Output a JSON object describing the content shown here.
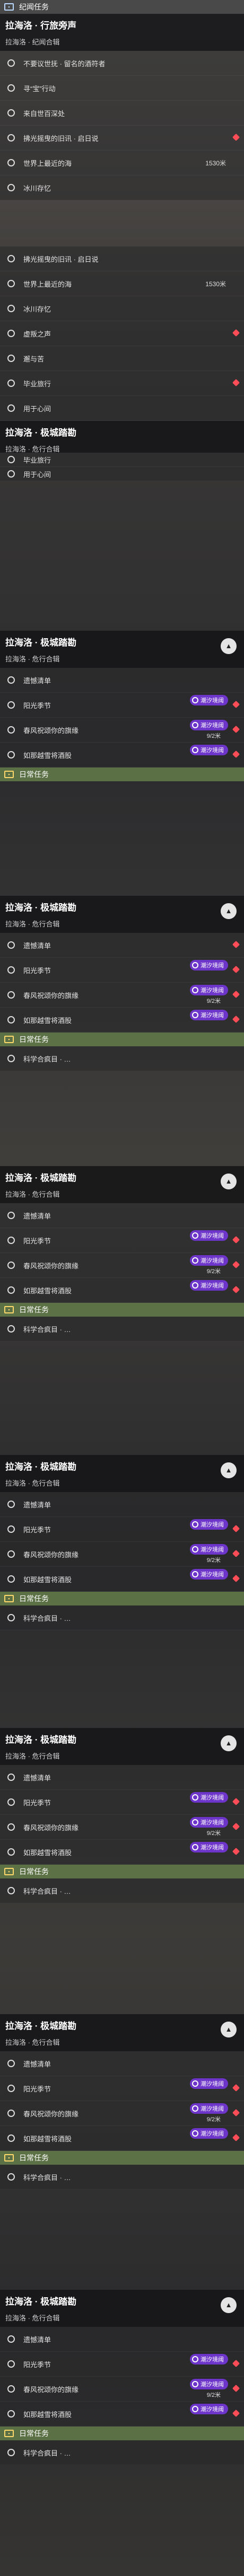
{
  "app": {
    "title": "任务追踪"
  },
  "icons": {
    "circle": "radio-circle-icon",
    "chevron": "chevron-up-icon",
    "marker": "red-diamond-marker-icon",
    "tag": "purple-story-tag-icon"
  },
  "colors": {
    "tag_purple": "#6d35c9",
    "marker_red": "#ff4d57",
    "daily_green": "#607646",
    "header_dark": "#161618"
  },
  "top": {
    "category": "纪闻任务",
    "header": {
      "title": "拉海洛 · 行旅旁声",
      "subtitle": "拉海洛 · 纪闻合辑"
    },
    "items": [
      {
        "label": "不要议世抚 · 留名的酒符者"
      },
      {
        "label": "寻“宝”行动"
      },
      {
        "label": "来自世百深处"
      },
      {
        "label": "拂光摇曳的旧讯 · 启日说"
      },
      {
        "label": "世界上最近的海",
        "distance": "1530米"
      },
      {
        "label": "冰川存忆"
      }
    ]
  },
  "second": {
    "items": [
      {
        "label": "拂光摇曳的旧讯 · 启日说"
      },
      {
        "label": "世界上最近的海",
        "distance": "1530米"
      },
      {
        "label": "冰川存忆"
      },
      {
        "label": "虚叛之声"
      },
      {
        "label": "邂与苦"
      },
      {
        "label": "毕业旅行"
      },
      {
        "label": "用于心间"
      }
    ]
  },
  "third": {
    "header": {
      "title": "拉海洛 · 极城踏勘",
      "subtitle": "拉海洛 · 危行合辑"
    },
    "peek": "毕业旅行",
    "peek2": "用于心间"
  },
  "blocks": [
    {
      "header": {
        "title": "拉海洛 · 极城踏勘",
        "subtitle": "拉海洛 · 危行合辑"
      },
      "items": [
        {
          "label": "遗憾清单"
        },
        {
          "label": "阳光季节",
          "tag": "潮汐境阈"
        },
        {
          "label": "春风祝颂你的旗缘",
          "tag": "潮汐境阈",
          "distance": "9/2米"
        },
        {
          "label": "如那越雪将酒股",
          "tag": "潮汐境阈"
        }
      ],
      "daily": "日常任务"
    },
    {
      "header": {
        "title": "拉海洛 · 极城踏勘",
        "subtitle": "拉海洛 · 危行合辑"
      },
      "items": [
        {
          "label": "遗憾清单"
        },
        {
          "label": "阳光季节",
          "tag": "潮汐境阈"
        },
        {
          "label": "春风祝颂你的旗缘",
          "tag": "潮汐境阈",
          "distance": "9/2米"
        },
        {
          "label": "如那越雪将酒股",
          "tag": "潮汐境阈"
        }
      ],
      "daily": "日常任务",
      "science": "科学合疯目 · …"
    },
    {
      "header": {
        "title": "拉海洛 · 极城踏勘",
        "subtitle": "拉海洛 · 危行合辑"
      },
      "items": [
        {
          "label": "遗憾清单"
        },
        {
          "label": "阳光季节",
          "tag": "潮汐境阈"
        },
        {
          "label": "春风祝颂你的旗缘",
          "tag": "潮汐境阈",
          "distance": "9/2米"
        },
        {
          "label": "如那越雪将酒股",
          "tag": "潮汐境阈"
        }
      ],
      "daily": "日常任务",
      "science": "科学合疯目 · …"
    },
    {
      "header": {
        "title": "拉海洛 · 极城踏勘",
        "subtitle": "拉海洛 · 危行合辑"
      },
      "items": [
        {
          "label": "遗憾清单"
        },
        {
          "label": "阳光季节",
          "tag": "潮汐境阈"
        },
        {
          "label": "春风祝颂你的旗缘",
          "tag": "潮汐境阈",
          "distance": "9/2米"
        },
        {
          "label": "如那越雪将酒股",
          "tag": "潮汐境阈"
        }
      ],
      "daily": "日常任务",
      "science": "科学合疯目 · …"
    },
    {
      "header": {
        "title": "拉海洛 · 极城踏勘",
        "subtitle": "拉海洛 · 危行合辑"
      },
      "items": [
        {
          "label": "遗憾清单"
        },
        {
          "label": "阳光季节",
          "tag": "潮汐境阈"
        },
        {
          "label": "春风祝颂你的旗缘",
          "tag": "潮汐境阈",
          "distance": "9/2米"
        },
        {
          "label": "如那越雪将酒股",
          "tag": "潮汐境阈"
        }
      ],
      "daily": "日常任务",
      "science": "科学合疯目 · …"
    },
    {
      "header": {
        "title": "拉海洛 · 极城踏勘",
        "subtitle": "拉海洛 · 危行合辑"
      },
      "items": [
        {
          "label": "遗憾清单"
        },
        {
          "label": "阳光季节",
          "tag": "潮汐境阈"
        },
        {
          "label": "春风祝颂你的旗缘",
          "tag": "潮汐境阈",
          "distance": "9/2米"
        },
        {
          "label": "如那越雪将酒股",
          "tag": "潮汐境阈"
        }
      ],
      "daily": "日常任务",
      "science": "科学合疯目 · …"
    },
    {
      "header": {
        "title": "拉海洛 · 极城踏勘",
        "subtitle": "拉海洛 · 危行合辑"
      },
      "items": [
        {
          "label": "遗憾清单"
        },
        {
          "label": "阳光季节",
          "tag": "潮汐境阈"
        },
        {
          "label": "春风祝颂你的旗缘",
          "tag": "潮汐境阈",
          "distance": "9/2米"
        },
        {
          "label": "如那越雪将酒股",
          "tag": "潮汐境阈"
        }
      ],
      "daily": "日常任务",
      "science": "科学合疯目 · …"
    }
  ]
}
